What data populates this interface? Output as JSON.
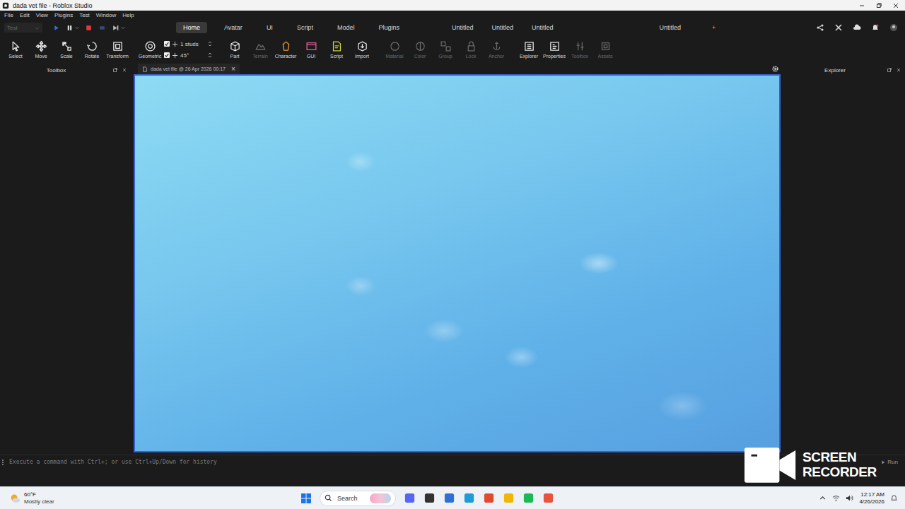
{
  "window": {
    "title": "dada vet file - Roblox Studio"
  },
  "menu": [
    "File",
    "Edit",
    "View",
    "Plugins",
    "Test",
    "Window",
    "Help"
  ],
  "ribbon": {
    "mode": {
      "label": "Test",
      "disabled": true
    },
    "tabs": [
      {
        "label": "Home",
        "selected": true
      },
      {
        "label": "Avatar",
        "selected": false
      },
      {
        "label": "UI",
        "selected": false
      },
      {
        "label": "Script",
        "selected": false
      },
      {
        "label": "Model",
        "selected": false
      },
      {
        "label": "Plugins",
        "selected": false
      }
    ],
    "documents": [
      "Untitled",
      "Untitled",
      "Untitled"
    ],
    "place": "Untitled",
    "add": "+"
  },
  "toolbar": {
    "groups": [
      [
        {
          "kind": "tool",
          "label": "Select",
          "disabled": false
        },
        {
          "kind": "tool",
          "label": "Move",
          "disabled": false
        },
        {
          "kind": "tool",
          "label": "Scale",
          "disabled": false
        },
        {
          "kind": "tool",
          "label": "Rotate",
          "disabled": false
        },
        {
          "kind": "tool",
          "label": "Transform",
          "disabled": false
        }
      ],
      [
        {
          "kind": "tool",
          "label": "Geometric",
          "disabled": false
        },
        {
          "kind": "setting",
          "label": "1 studs",
          "checked": true
        },
        {
          "kind": "setting",
          "label": "45°",
          "checked": true
        }
      ],
      [
        {
          "kind": "tool",
          "label": "Part",
          "disabled": false
        },
        {
          "kind": "tool",
          "label": "Terrain",
          "disabled": true
        },
        {
          "kind": "tool",
          "label": "Character",
          "disabled": false
        },
        {
          "kind": "tool",
          "label": "GUI",
          "disabled": false
        },
        {
          "kind": "tool",
          "label": "Script",
          "disabled": false
        },
        {
          "kind": "tool",
          "label": "Import",
          "disabled": false
        }
      ],
      [
        {
          "kind": "tool",
          "label": "Material",
          "disabled": true
        },
        {
          "kind": "tool",
          "label": "Color",
          "disabled": true
        },
        {
          "kind": "tool",
          "label": "Group",
          "disabled": true
        },
        {
          "kind": "tool",
          "label": "Lock",
          "disabled": true
        },
        {
          "kind": "tool",
          "label": "Anchor",
          "disabled": true
        }
      ],
      [
        {
          "kind": "tool",
          "label": "Explorer",
          "disabled": false
        },
        {
          "kind": "tool",
          "label": "Properties",
          "disabled": false
        },
        {
          "kind": "tool",
          "label": "Toolbox",
          "disabled": true
        },
        {
          "kind": "tool",
          "label": "Assets",
          "disabled": true
        }
      ]
    ]
  },
  "panels": {
    "toolbox": {
      "title": "Toolbox"
    },
    "explorer": {
      "title": "Explorer"
    }
  },
  "document_tab": {
    "label": "dada vet file @ 26 Apr 2026 00:17",
    "close": "×"
  },
  "command_bar": {
    "placeholder": "Execute a command with Ctrl+; or use Ctrl+Up/Down for history",
    "run": "Run"
  },
  "watermark": [
    "SCREEN",
    "RECORDER"
  ],
  "taskbar": {
    "weather": {
      "temp": "60°F",
      "condition": "Mostly clear"
    },
    "search": "Search",
    "time": "12:17 AM",
    "date": "4/26/2026"
  }
}
